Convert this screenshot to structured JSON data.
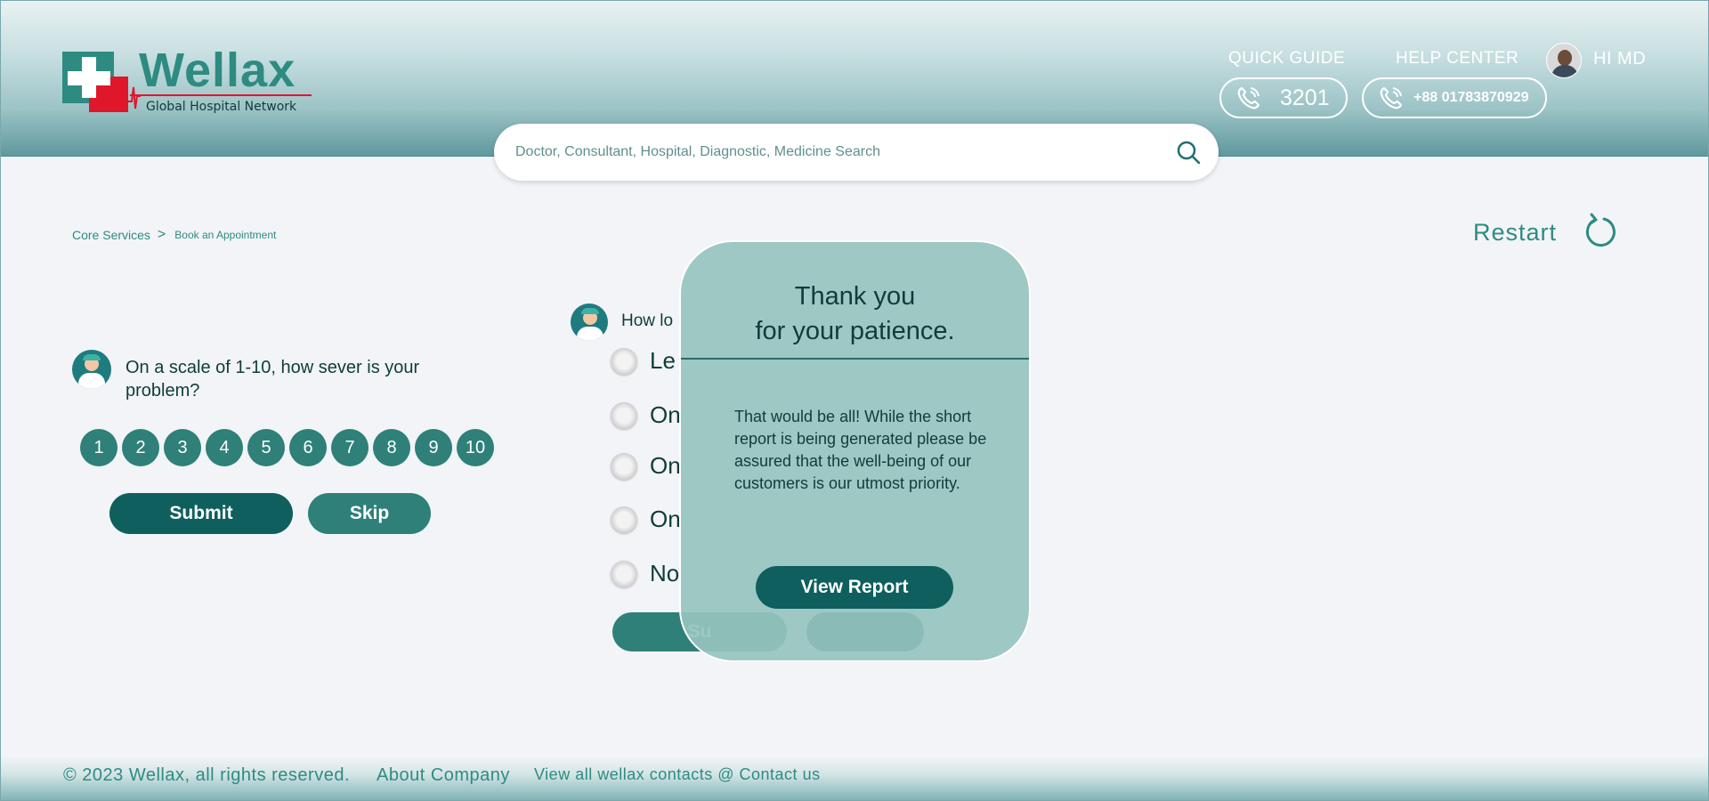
{
  "brand": {
    "name": "Wellax",
    "tagline": "Global Hospital Network"
  },
  "header": {
    "quick_guide_label": "QUICK GUIDE",
    "quick_guide_number": "3201",
    "help_center_label": "HELP CENTER",
    "help_center_number": "+88 01783870929",
    "user_greeting": "HI MD"
  },
  "search": {
    "placeholder": "Doctor, Consultant, Hospital, Diagnostic, Medicine Search"
  },
  "breadcrumb": {
    "items": [
      "Core Services",
      "Book an Appointment"
    ],
    "separator": ">"
  },
  "restart_label": "Restart",
  "question1": {
    "text": "On a scale of 1-10, how sever is your problem?",
    "scale": [
      "1",
      "2",
      "3",
      "4",
      "5",
      "6",
      "7",
      "8",
      "9",
      "10"
    ],
    "submit_label": "Submit",
    "skip_label": "Skip"
  },
  "question2": {
    "text": "How lo",
    "options": [
      "Le",
      "On",
      "On",
      "On",
      "No"
    ],
    "submit_label": "Su"
  },
  "modal": {
    "title_line1": "Thank you",
    "title_line2": "for your patience.",
    "message": "That would be all! While the short report is being generated please be assured that the well-being of our customers is our utmost priority.",
    "button_label": "View Report"
  },
  "footer": {
    "copyright": "© 2023 Wellax, all rights reserved.",
    "about": "About Company",
    "contact": "View all wellax contacts @ Contact us"
  },
  "colors": {
    "primary": "#0e5f5e",
    "accent": "#2e8b81",
    "brand_red": "#e0162b",
    "modal_bg": "#96c3be"
  }
}
